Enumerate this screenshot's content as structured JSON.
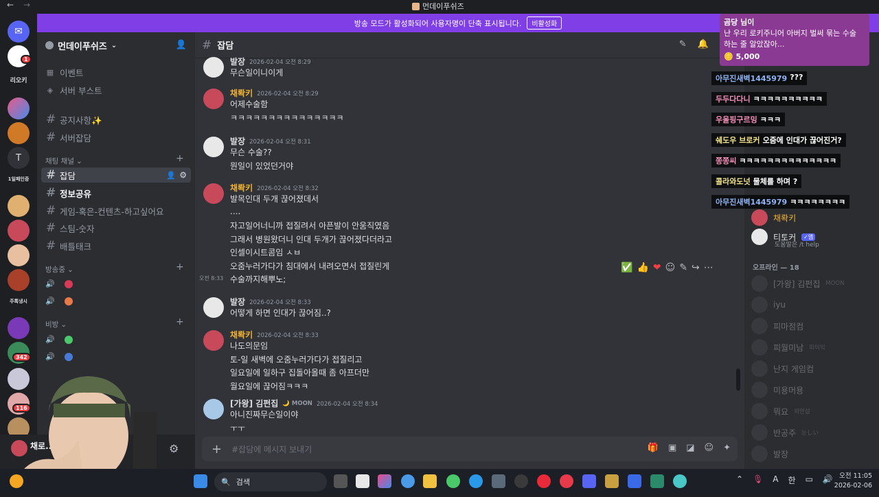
{
  "window": {
    "title": "먼데이푸쉬즈",
    "back": "←",
    "forward": "→"
  },
  "banner": {
    "text": "방송 모드가 활성화되어 사용자명이 단축 표시됩니다.",
    "button": "비활성화"
  },
  "guilds": {
    "texts": [
      "리오키",
      "T",
      "1일패인증",
      "주톡냉시"
    ],
    "badges": [
      "1",
      "342",
      "116"
    ]
  },
  "server": {
    "name": "먼데이푸쉬즈",
    "top_items": [
      "이벤트",
      "서버 부스트"
    ],
    "channels_top": [
      "공지사항✨",
      "서버잡담"
    ],
    "category_chat": "채팅 채널",
    "channels_chat": [
      "잡담",
      "정보공유",
      "게임-혹은-컨텐츠-하고싶어요",
      "스팀-숫자",
      "배틀태크"
    ],
    "category_live": "방송중",
    "category_secret": "비방"
  },
  "user_panel": {
    "name": "채로..."
  },
  "chat": {
    "channel": "잡담",
    "composer_placeholder": "#잡담에 메시지 보내기",
    "messages": [
      {
        "author": "발장",
        "color": "#dbdee1",
        "time": "2026-02-04 오전 8:29",
        "lines": [
          "무슨일이니이게"
        ]
      },
      {
        "author": "채롹키",
        "color": "#f0b232",
        "time": "2026-02-04 오전 8:29",
        "lines": [
          "어제수술함",
          "ㅋㅋㅋㅋㅋㅋㅋㅋㅋㅋㅋㅋㅋㅋㅋ"
        ]
      },
      {
        "author": "발장",
        "color": "#dbdee1",
        "time": "2026-02-04 오전 8:31",
        "lines": [
          "무슨 수술??",
          "뭔일이 있었던거야"
        ]
      },
      {
        "author": "채롹키",
        "color": "#f0b232",
        "time": "2026-02-04 오전 8:32",
        "lines": [
          "발목인대 두개 끊어졌데서",
          "....",
          "자고일어너니까 접질려서 아픈발이 안움직였음",
          "그래서 병원왔더니 인대 두개가 끊어졌다더라고",
          "인셀이시트콤임 ㅅㅂ",
          "오줌누러가다가 침대에서 내려오면서 접질린게",
          "수술까지해뿌노;"
        ],
        "side_time": "오전 8:33"
      },
      {
        "author": "발장",
        "color": "#dbdee1",
        "time": "2026-02-04 오전 8:33",
        "lines": [
          "어떻게 하면 인대가 끊어짐..?"
        ]
      },
      {
        "author": "채롹키",
        "color": "#f0b232",
        "time": "2026-02-04 오전 8:33",
        "lines": [
          "나도의문임",
          "토-일 새벽에 오줌누러가다가 접질리고",
          "일요일에 일하구 집돌아올때 좀 아프더만",
          "월요일에 끊어짐ㅋㅋㅋ"
        ]
      },
      {
        "author": "[가왕] 김펀집",
        "color": "#dbdee1",
        "time": "2026-02-04 오전 8:34",
        "lines": [
          "아니진짜무슨일이야",
          "ㅜㅜ"
        ],
        "tag": "MOON"
      }
    ]
  },
  "members": {
    "online": [
      {
        "name": "채롹키",
        "color": "#f0b232"
      },
      {
        "name": "티토커",
        "sub": "도움말은 /t help",
        "tag": "앱"
      }
    ],
    "offline_label": "오프라인 — 18",
    "offline": [
      {
        "name": "[가왕] 김펀집",
        "tag": "MOON"
      },
      {
        "name": "iyu"
      },
      {
        "name": "피마점컴"
      },
      {
        "name": "피월미남",
        "tag": "피이익"
      },
      {
        "name": "난지 게임컴"
      },
      {
        "name": "미용머용"
      },
      {
        "name": "뭐요",
        "tag": "외만섭"
      },
      {
        "name": "반공주",
        "tag": "눈しい"
      },
      {
        "name": "발장"
      }
    ]
  },
  "stream_overlay": {
    "donation": {
      "name": "곰당 님이",
      "message": "난 우리 로키주니어 아버지 벌써 묶는 수술 하는 줄 알았잖아...",
      "amount": "5,000"
    },
    "chat": [
      {
        "name": "아무진새벽1445979",
        "text": "???",
        "color": "blue"
      },
      {
        "name": "두두다다니",
        "text": "ㅋㅋㅋㅋㅋㅋㅋㅋㅋㅋ",
        "color": "pink"
      },
      {
        "name": "우울핑구르밍",
        "text": "ㅋㅋㅋ",
        "color": "pink"
      },
      {
        "name": "쉐도우 브로커",
        "text": "오줌에 인대가 끊어진거?",
        "color": "yellow"
      },
      {
        "name": "쫑쫑씨",
        "text": "ㅋㅋㅋㅋㅋㅋㅋㅋㅋㅋㅋㅋㅋㅋ",
        "color": "pink"
      },
      {
        "name": "콜라와도넛",
        "text": "물체를 하며 ?",
        "color": "yellow"
      },
      {
        "name": "아무진새벽1445979",
        "text": "ㅋㅋㅋㅋㅋㅋㅋㅋ",
        "color": "blue"
      }
    ]
  },
  "taskbar": {
    "search": "검색",
    "time": "오전 11:05",
    "date": "2026-02-06",
    "lang": "한",
    "ime": "A"
  }
}
